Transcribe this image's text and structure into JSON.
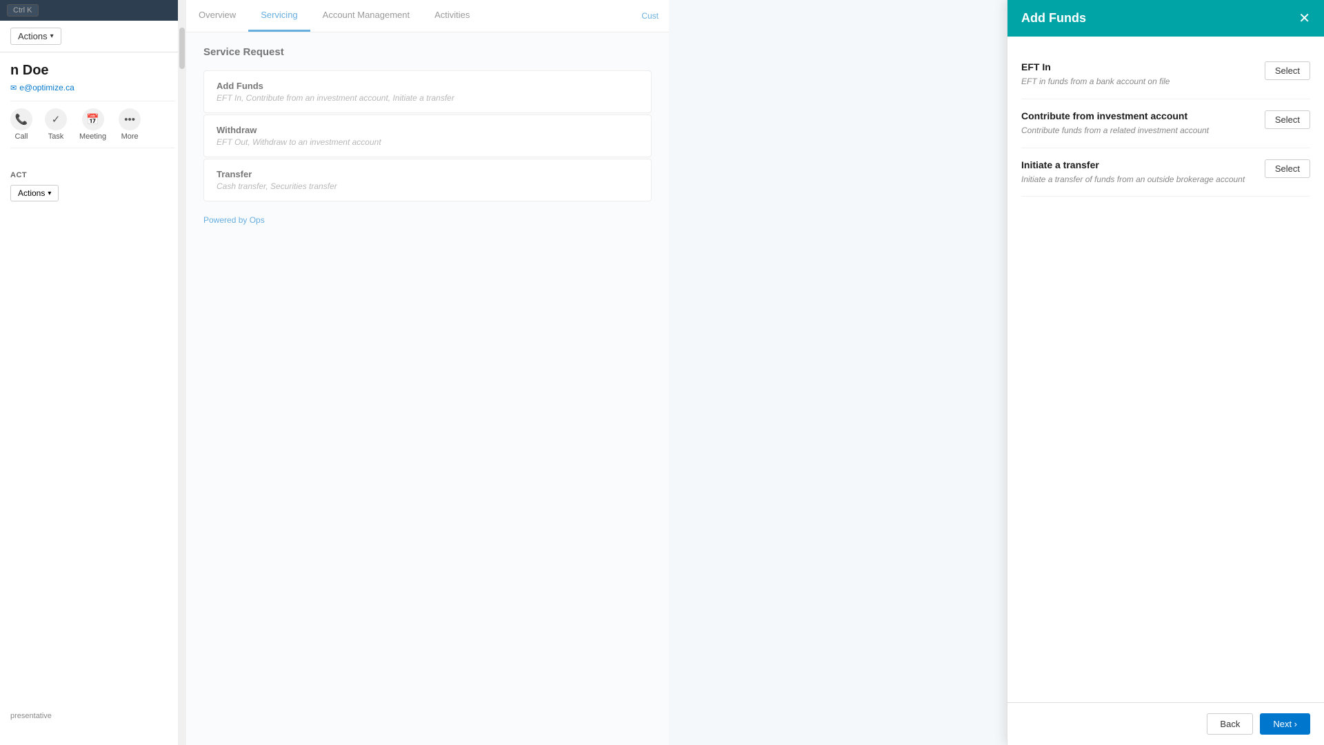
{
  "sidebar": {
    "ctrl_k": "Ctrl K",
    "actions_label": "Actions",
    "contact_name": "n Doe",
    "contact_email": "e@optimize.ca",
    "contact_actions": [
      {
        "icon": "📞",
        "label": "Call"
      },
      {
        "icon": "✓",
        "label": "Task"
      },
      {
        "icon": "📅",
        "label": "Meeting"
      },
      {
        "icon": "•••",
        "label": "More"
      }
    ],
    "section_label": "act",
    "actions_dropdown": "Actions",
    "bottom_text": "presentative"
  },
  "main": {
    "tabs": [
      {
        "label": "Overview",
        "active": false
      },
      {
        "label": "Servicing",
        "active": true
      },
      {
        "label": "Account Management",
        "active": false
      },
      {
        "label": "Activities",
        "active": false
      }
    ],
    "cust_link": "Cust",
    "service_request_title": "Service Request",
    "service_cards": [
      {
        "title": "Add Funds",
        "desc": "EFT In, Contribute from an investment account, Initiate a transfer"
      },
      {
        "title": "Withdraw",
        "desc": "EFT Out, Withdraw to an investment account"
      },
      {
        "title": "Transfer",
        "desc": "Cash transfer, Securities transfer"
      }
    ],
    "powered_by_prefix": "Powered by ",
    "powered_by_brand": "Ops"
  },
  "add_funds_panel": {
    "title": "Add Funds",
    "options": [
      {
        "title": "EFT In",
        "desc": "EFT in funds from a bank account on file",
        "btn_label": "Select"
      },
      {
        "title": "Contribute from investment account",
        "desc": "Contribute funds from a related investment account",
        "btn_label": "Select"
      },
      {
        "title": "Initiate a transfer",
        "desc": "Initiate a transfer of funds from an outside brokerage account",
        "btn_label": "Select"
      }
    ],
    "footer": {
      "back_label": "Back",
      "next_label": "Next ›"
    }
  }
}
